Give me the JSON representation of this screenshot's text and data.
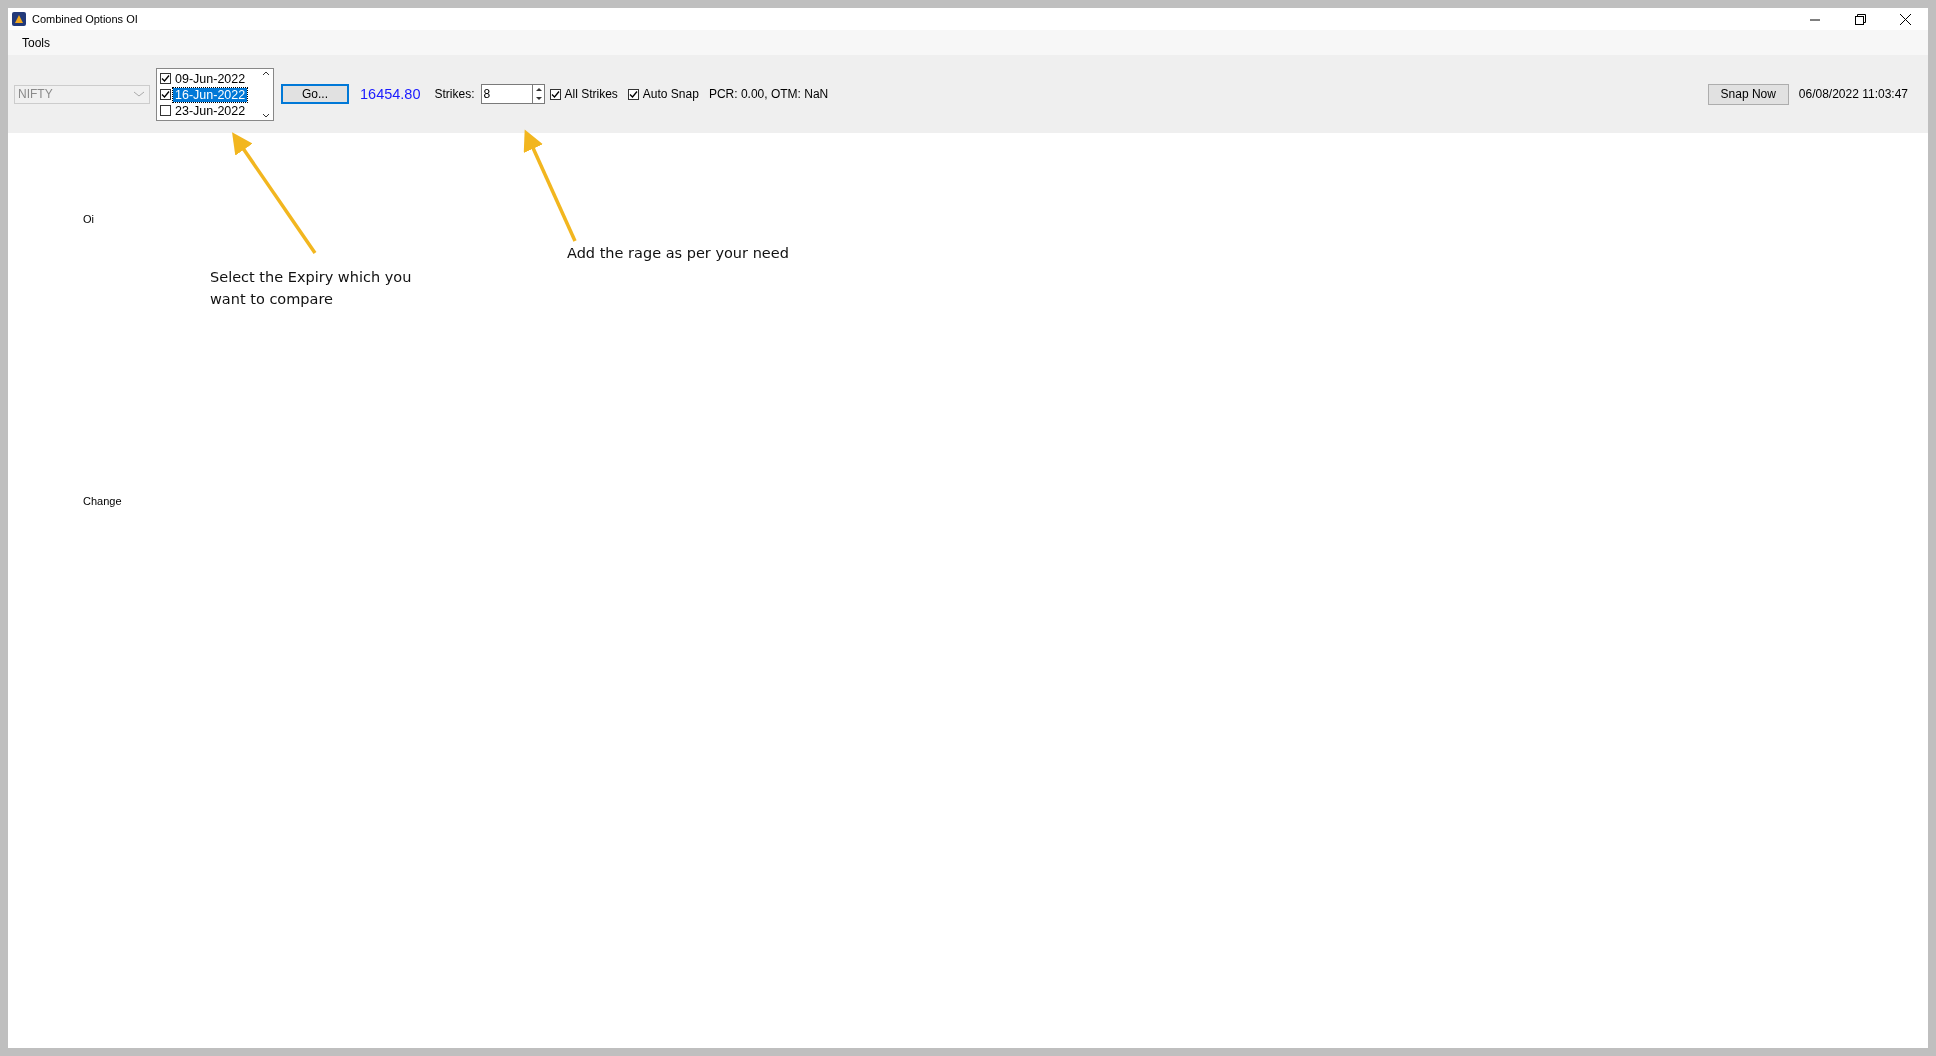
{
  "window": {
    "title": "Combined Options OI"
  },
  "menu": [
    "Tools"
  ],
  "toolbar": {
    "symbol": {
      "value": "NIFTY",
      "disabled": true
    },
    "expiries": [
      {
        "label": "09-Jun-2022",
        "checked": true,
        "selected": false
      },
      {
        "label": "16-Jun-2022",
        "checked": true,
        "selected": true
      },
      {
        "label": "23-Jun-2022",
        "checked": false,
        "selected": false
      }
    ],
    "go_button": "Go...",
    "price": "16454.80",
    "strikes_label": "Strikes:",
    "strikes_value": "8",
    "options": [
      {
        "label": "All Strikes",
        "checked": true
      },
      {
        "label": "Auto Snap",
        "checked": true
      }
    ],
    "stats": "PCR: 0.00,  OTM: NaN",
    "snap_button": "Snap Now",
    "timestamp": "06/08/2022 11:03:47"
  },
  "panels": [
    "Oi",
    "Change"
  ],
  "annotations": [
    "Select the Expiry which you want to compare",
    "Add the rage as per your need"
  ]
}
